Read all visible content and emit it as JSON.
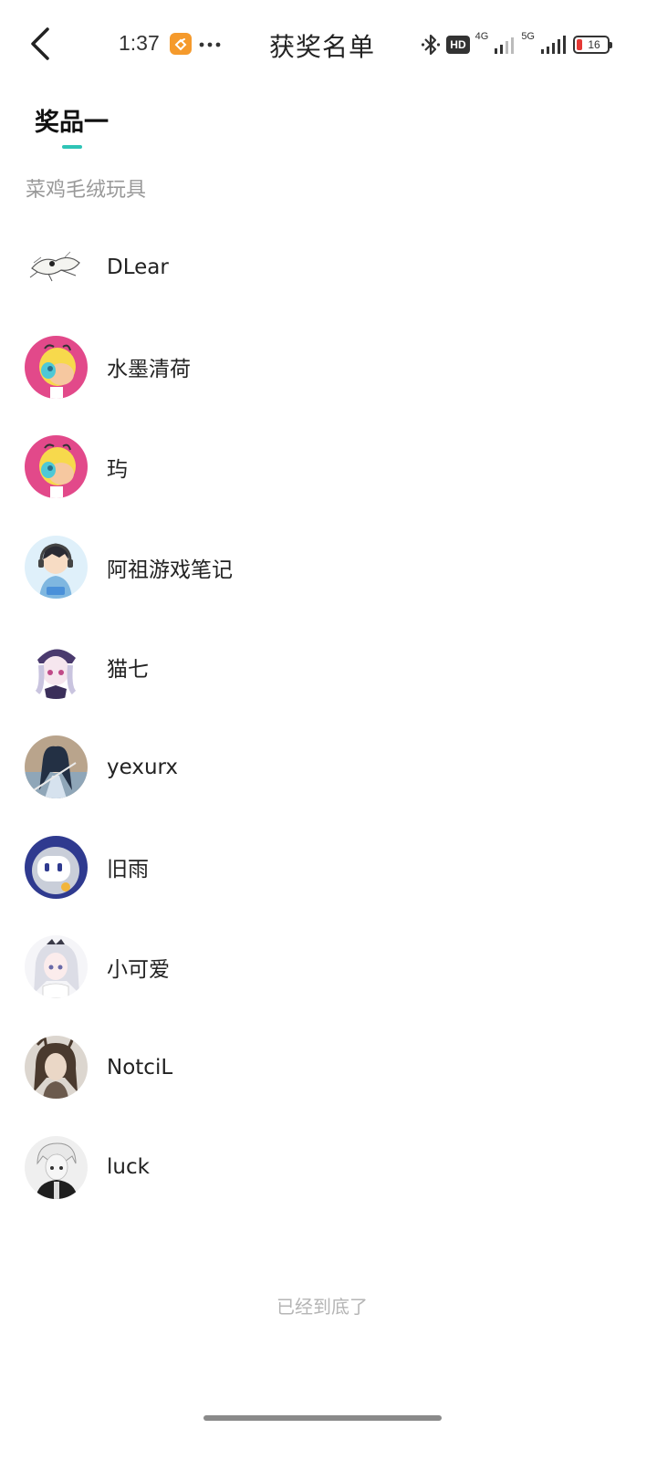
{
  "status_bar": {
    "time": "1:37",
    "hd_label": "HD",
    "network_1": "4G",
    "network_2": "5G",
    "battery_level": "16"
  },
  "header": {
    "title": "获奖名单"
  },
  "tab": {
    "label": "奖品一",
    "accent_color": "#2ec4b6"
  },
  "prize": {
    "name": "菜鸡毛绒玩具"
  },
  "winners": [
    {
      "name": "DLear",
      "avatar": "sketch-avatar"
    },
    {
      "name": "水墨清荷",
      "avatar": "pink-mascot-avatar"
    },
    {
      "name": "玙",
      "avatar": "pink-mascot-avatar"
    },
    {
      "name": "阿祖游戏笔记",
      "avatar": "anime-boy-headphones-avatar"
    },
    {
      "name": "猫七",
      "avatar": "anime-girl-hat-avatar"
    },
    {
      "name": "yexurx",
      "avatar": "anime-swordsman-avatar"
    },
    {
      "name": "旧雨",
      "avatar": "blue-robot-avatar"
    },
    {
      "name": "小可爱",
      "avatar": "white-hair-girl-avatar"
    },
    {
      "name": "NotciL",
      "avatar": "brown-hair-portrait-avatar"
    },
    {
      "name": "luck",
      "avatar": "monochrome-boy-avatar"
    }
  ],
  "footer": {
    "end_text": "已经到底了"
  }
}
